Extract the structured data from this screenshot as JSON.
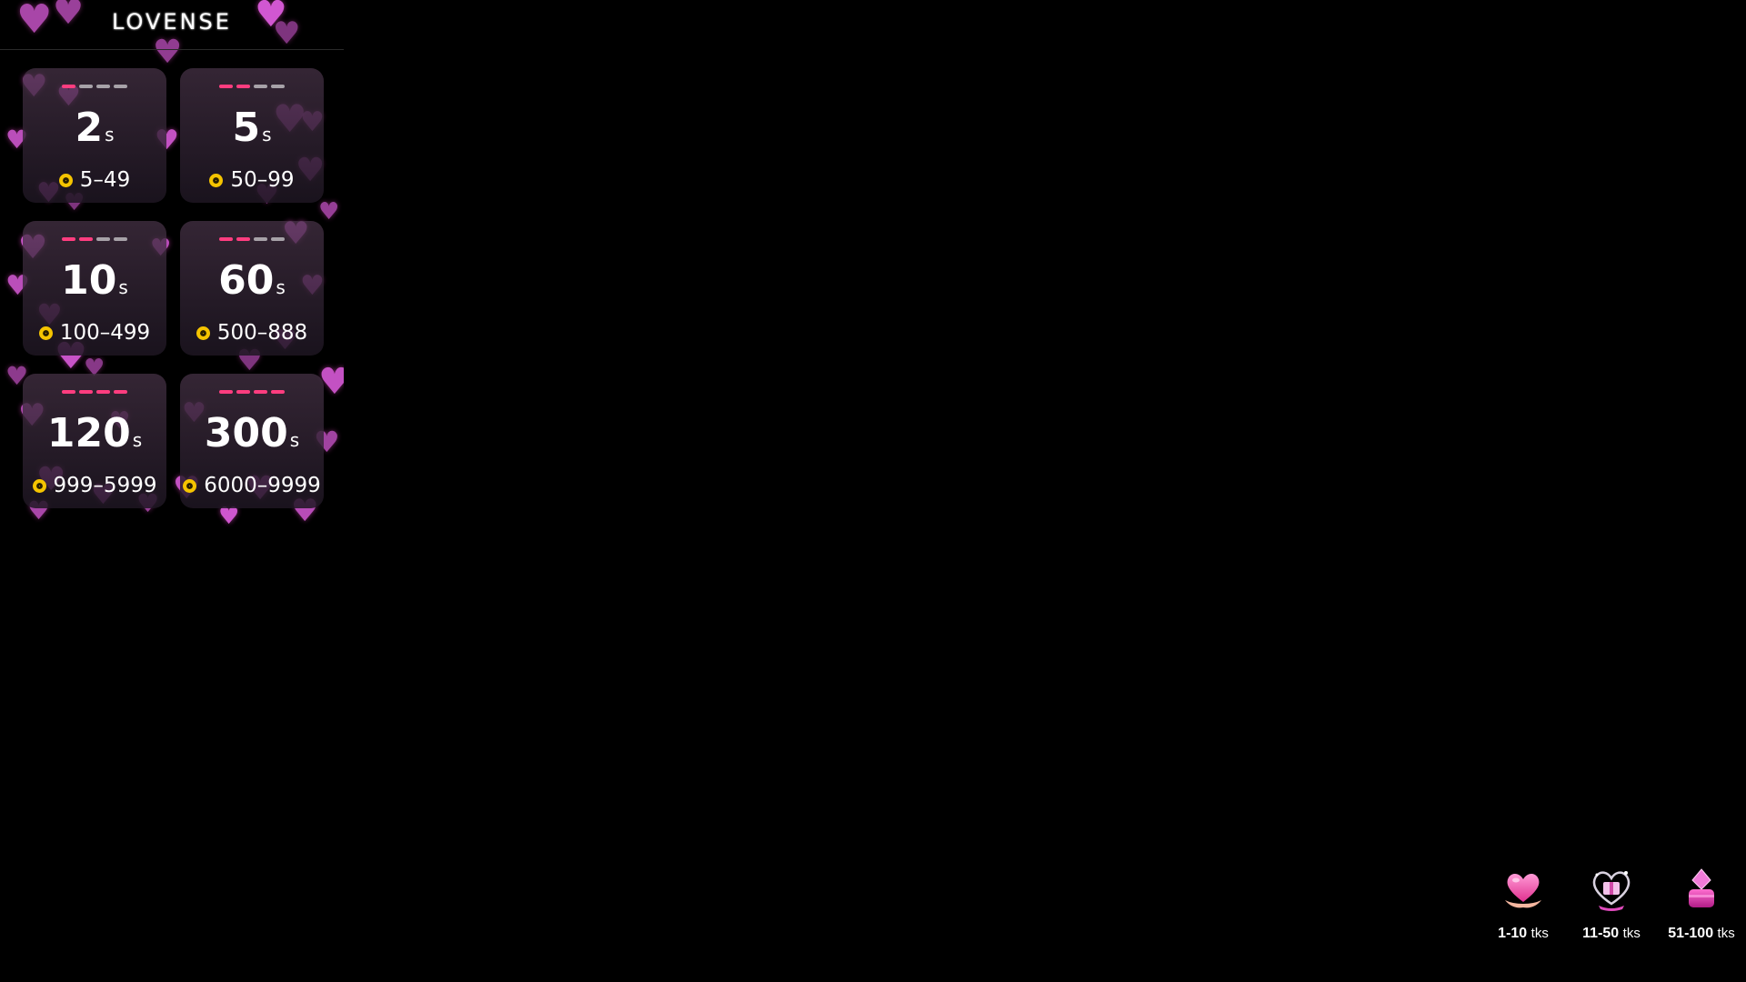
{
  "brand": {
    "logo_text": "LOVENSE"
  },
  "levels": [
    {
      "duration": "2",
      "unit": "s",
      "range": "5–49",
      "active_bars": 1,
      "total_bars": 4
    },
    {
      "duration": "5",
      "unit": "s",
      "range": "50–99",
      "active_bars": 2,
      "total_bars": 4
    },
    {
      "duration": "10",
      "unit": "s",
      "range": "100–499",
      "active_bars": 2,
      "total_bars": 4
    },
    {
      "duration": "60",
      "unit": "s",
      "range": "500–888",
      "active_bars": 2,
      "total_bars": 4
    },
    {
      "duration": "120",
      "unit": "s",
      "range": "999–5999",
      "active_bars": 4,
      "total_bars": 4
    },
    {
      "duration": "300",
      "unit": "s",
      "range": "6000–9999",
      "active_bars": 4,
      "total_bars": 4
    }
  ],
  "tip_menu": [
    {
      "range": "1-10",
      "unit": "tks",
      "icon": "heart-hands-icon"
    },
    {
      "range": "11-50",
      "unit": "tks",
      "icon": "heart-gift-icon"
    },
    {
      "range": "51-100",
      "unit": "tks",
      "icon": "ring-box-icon"
    }
  ],
  "colors": {
    "background": "#000000",
    "heart": "#e660e6",
    "bar_active": "#ff3d7f",
    "bar_inactive": "#a7a2a8",
    "coin": "#f5c400"
  }
}
